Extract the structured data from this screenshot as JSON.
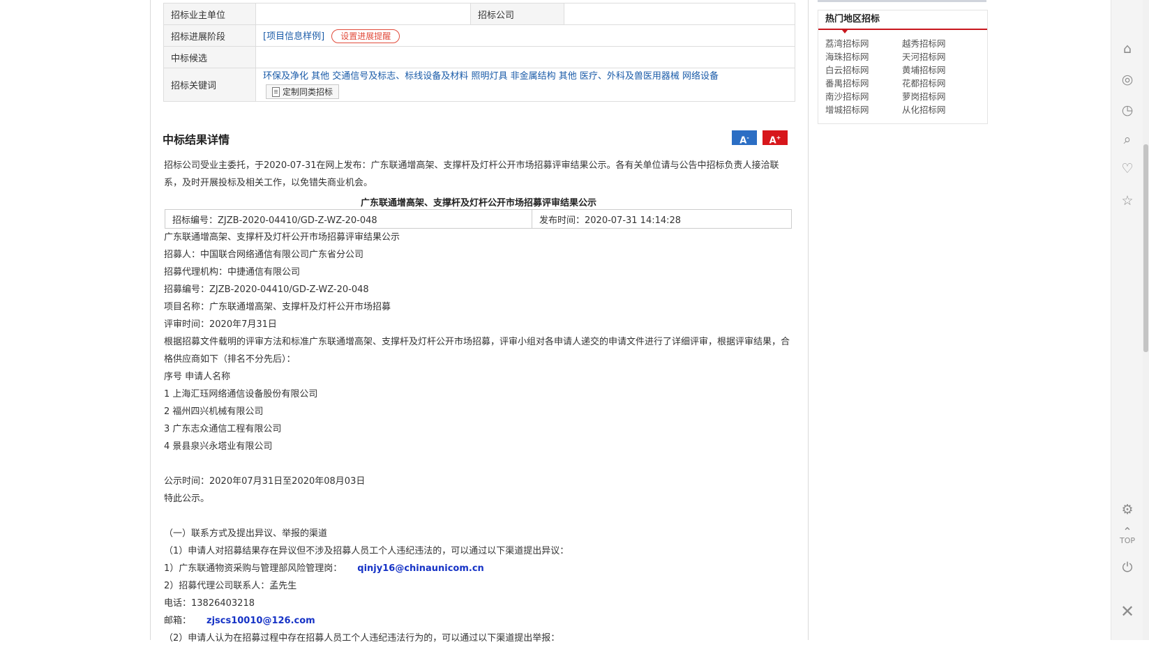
{
  "info": {
    "owner_label": "招标业主单位",
    "owner_value": "",
    "company_label": "招标公司",
    "company_value": "",
    "stage_label": "招标进展阶段",
    "stage_link": "[项目信息样例]",
    "stage_remind": "设置进展提醒",
    "candidate_label": "中标候选",
    "candidate_value": "",
    "keywords_label": "招标关键词",
    "keywords": [
      "环保及净化 其他",
      "交通信号及标志、标线设备及材料",
      "照明灯具",
      "非金属结构 其他",
      "医疗、外科及兽医用器械",
      "网络设备"
    ],
    "custom_button": "定制同类招标"
  },
  "section": {
    "title": "中标结果详情",
    "font_small": "A",
    "font_big": "A"
  },
  "intro": "招标公司受业主委托，于2020-07-31在网上发布：广东联通增高架、支撑杆及灯杆公开市场招募评审结果公示。各有关单位请与公告中招标负责人接洽联系，及时开展投标及相关工作，以免错失商业机会。",
  "notice": {
    "title": "广东联通增高架、支撑杆及灯杆公开市场招募评审结果公示",
    "bid_no": "招标编号：ZJZB-2020-04410/GD-Z-WZ-20-048",
    "publish_time": "发布时间：2020-07-31 14:14:28",
    "lines": [
      "广东联通增高架、支撑杆及灯杆公开市场招募评审结果公示",
      "招募人：中国联合网络通信有限公司广东省分公司",
      "招募代理机构：中捷通信有限公司",
      "招募编号：ZJZB-2020-04410/GD-Z-WZ-20-048",
      "项目名称：广东联通增高架、支撑杆及灯杆公开市场招募",
      "评审时间：2020年7月31日"
    ],
    "review_text": "根据招募文件载明的评审方法和标准广东联通增高架、支撑杆及灯杆公开市场招募，评审小组对各申请人递交的申请文件进行了详细评审，根据评审结果，合格供应商如下（排名不分先后）：",
    "list_header": "序号 申请人名称",
    "suppliers": [
      "1 上海汇珏网络通信设备股份有限公司",
      "2 福州四兴机械有限公司",
      "3 广东志众通信工程有限公司",
      "4 景县泉兴永塔业有限公司"
    ],
    "period": "公示时间：2020年07月31日至2020年08月03日",
    "hereby": "特此公示。",
    "contact_title": "（一）联系方式及提出异议、举报的渠道",
    "contact_1": "（1）申请人对招募结果存在异议但不涉及招募人员工个人违纪违法的，可以通过以下渠道提出异议：",
    "contact_1_1": "1）广东联通物资采购与管理部风险管理岗：",
    "email_1": "qinjy16@chinaunicom.cn",
    "contact_1_2": "2）招募代理公司联系人：孟先生",
    "phone": "电话：13826403218",
    "mail_label": "邮箱：",
    "email_2": "zjscs10010@126.com",
    "contact_2": "（2）申请人认为在招募过程中存在招募人员工个人违纪违法行为的，可以通过以下渠道提出举报："
  },
  "hot": {
    "title": "热门地区招标",
    "items": [
      "荔湾招标网",
      "越秀招标网",
      "海珠招标网",
      "天河招标网",
      "白云招标网",
      "黄埔招标网",
      "番禺招标网",
      "花都招标网",
      "南沙招标网",
      "萝岗招标网",
      "增城招标网",
      "从化招标网"
    ]
  },
  "toolbar": {
    "top_label": "TOP"
  }
}
